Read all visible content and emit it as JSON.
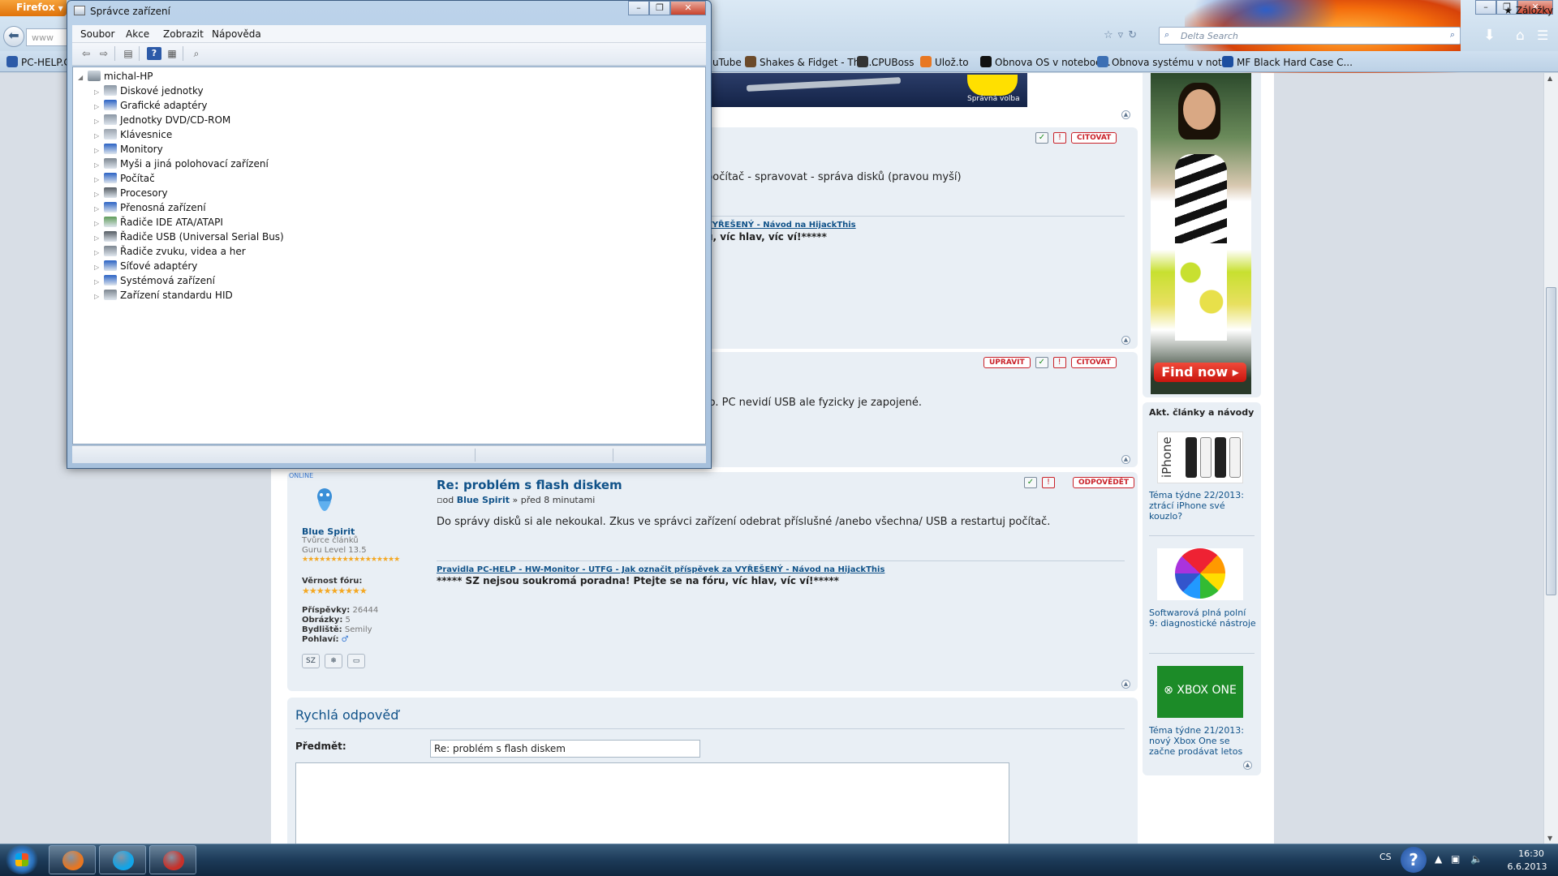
{
  "firefox": {
    "menu_label": "Firefox",
    "url_text": "www",
    "search_placeholder": "Delta Search",
    "bookmarks_label": "Záložky",
    "bookmarks": [
      {
        "label": "PC-HELP.C",
        "color": "#2b5aa8"
      },
      {
        "label": "uTube",
        "color": "#d33"
      },
      {
        "label": "Shakes & Fidget - The ...",
        "color": "#6b4a2a"
      },
      {
        "label": "CPUBoss",
        "color": "#333"
      },
      {
        "label": "Ulož.to",
        "color": "#e87722"
      },
      {
        "label": "Obnova OS v noteboo...",
        "color": "#111"
      },
      {
        "label": "Obnova systému v not...",
        "color": "#3c6fb4"
      },
      {
        "label": "MF Black Hard Case C...",
        "color": "#1c4ea0"
      }
    ]
  },
  "ad_banner": {
    "label": "Správná volba"
  },
  "posts": [
    {
      "text": "počítač - spravovat - správa disků (pravou myší)",
      "sig_links": "VYŘEŠENÝ - Návod na HijackThis",
      "sig_bold": "u, víc hlav, víc ví!*****",
      "buttons": [
        "CITOVAT"
      ]
    },
    {
      "text": "lo. PC nevidí USB ale fyzicky je zapojené.",
      "buttons": [
        "UPRAVIT",
        "CITOVAT"
      ]
    },
    {
      "online": "ONLINE",
      "title": "Re: problém s flash diskem",
      "meta_prefix": "od",
      "meta_author": "Blue Spirit",
      "meta_time": "» před 8 minutami",
      "author": "Blue Spirit",
      "rank": "Tvůrce článků",
      "level": "Guru Level 13.5",
      "vernost_label": "Věrnost fóru:",
      "stats": [
        {
          "label": "Příspěvky:",
          "value": "26444"
        },
        {
          "label": "Obrázky:",
          "value": "5"
        },
        {
          "label": "Bydliště:",
          "value": "Semily"
        },
        {
          "label": "Pohlaví:",
          "value": "♂"
        }
      ],
      "text": "Do správy disků si ale nekoukal. Zkus ve správci zařízení odebrat příslušné /anebo všechna/ USB a restartuj počítač.",
      "sig_links": "Pravidla PC-HELP - HW-Monitor - UTFG - Jak označit příspěvek za VYŘEŠENÝ - Návod na HijackThis",
      "sig_bold": "***** SZ nejsou soukromá poradna! Ptejte se na fóru, víc hlav, víc ví!*****",
      "buttons": [
        "ODPOVĚDĚT"
      ],
      "user_icons": [
        "SZ",
        "❄",
        "▭"
      ]
    }
  ],
  "quick_reply": {
    "title": "Rychlá odpověď",
    "subject_label": "Předmět:",
    "subject_value": "Re: problém s flash diskem"
  },
  "sidebar": {
    "find_now": "Find now ▸",
    "articles_title": "Akt. články a návody",
    "articles": [
      {
        "title": "Téma týdne 22/2013: ztrácí iPhone své kouzlo?",
        "image_text": "iPhone"
      },
      {
        "title": "Softwarová plná polní 9: diagnostické nástroje",
        "image_text": ""
      },
      {
        "title": "Téma týdne 21/2013: nový Xbox One se začne prodávat letos",
        "image_text": "XBOX ONE"
      }
    ]
  },
  "device_manager": {
    "title": "Správce zařízení",
    "menu": [
      "Soubor",
      "Akce",
      "Zobrazit",
      "Nápověda"
    ],
    "root": "michal-HP",
    "devices": [
      {
        "label": "Diskové jednotky",
        "color": "#8a96a3"
      },
      {
        "label": "Grafické adaptéry",
        "color": "#2a62c4"
      },
      {
        "label": "Jednotky DVD/CD-ROM",
        "color": "#8a96a3"
      },
      {
        "label": "Klávesnice",
        "color": "#9aa3ad"
      },
      {
        "label": "Monitory",
        "color": "#2a62c4"
      },
      {
        "label": "Myši a jiná polohovací zařízení",
        "color": "#7c8690"
      },
      {
        "label": "Počítač",
        "color": "#2a62c4"
      },
      {
        "label": "Procesory",
        "color": "#555c63"
      },
      {
        "label": "Přenosná zařízení",
        "color": "#2a62c4"
      },
      {
        "label": "Řadiče IDE ATA/ATAPI",
        "color": "#5f9c5a"
      },
      {
        "label": "Řadiče USB (Universal Serial Bus)",
        "color": "#555c63"
      },
      {
        "label": "Řadiče zvuku, videa a her",
        "color": "#7c8690"
      },
      {
        "label": "Síťové adaptéry",
        "color": "#2a62c4"
      },
      {
        "label": "Systémová zařízení",
        "color": "#2a62c4"
      },
      {
        "label": "Zařízení standardu HID",
        "color": "#7c8690"
      }
    ]
  },
  "taskbar": {
    "lang": "CS",
    "time": "16:30",
    "date": "6.6.2013",
    "apps": [
      {
        "name": "firefox",
        "color": "#e87722"
      },
      {
        "name": "skype",
        "color": "#12a5e8"
      },
      {
        "name": "toolbox",
        "color": "#c8312a"
      }
    ]
  }
}
